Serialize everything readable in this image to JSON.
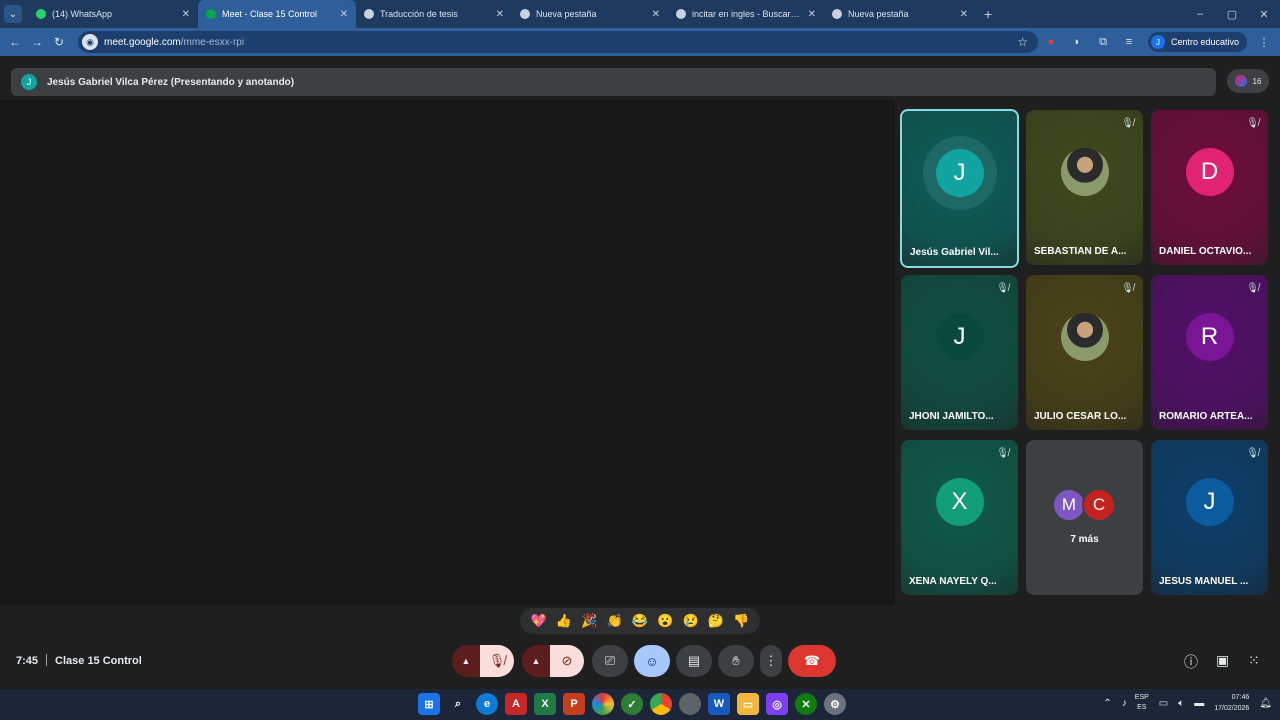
{
  "browser": {
    "tabs": [
      {
        "title": "(14) WhatsApp",
        "icon_color": "#25d366",
        "active": false
      },
      {
        "title": "Meet - Clase 15 Control",
        "icon_color": "#00ac47",
        "active": true
      },
      {
        "title": "Traducción de tesis",
        "icon_color": "#c8d2de",
        "active": false
      },
      {
        "title": "Nueva pestaña",
        "icon_color": "#c8d2de",
        "active": false
      },
      {
        "title": "incitar en ingles - Buscar con Google",
        "icon_color": "#c8d2de",
        "active": false
      },
      {
        "title": "Nueva pestaña",
        "icon_color": "#c8d2de",
        "active": false
      }
    ],
    "url_host": "meet.google.com",
    "url_path": "/mme-esxx-rpi",
    "profile_initial": "J",
    "profile_label": "Centro educativo"
  },
  "meet": {
    "presenter_initial": "J",
    "presenter_banner": "Jesús Gabriel Vilca Pérez (Presentando y anotando)",
    "participant_count": "16",
    "tiles": [
      {
        "name": "Jesús Gabriel Vil...",
        "initial": "J",
        "avatar_color": "#12a4a0",
        "bg": "#0d5d5a",
        "speaking": true,
        "muted": false,
        "photo": false
      },
      {
        "name": "SEBASTIAN DE A...",
        "initial": "",
        "avatar_color": "",
        "bg": "#3f4a1e",
        "speaking": false,
        "muted": true,
        "photo": true
      },
      {
        "name": "DANIEL OCTAVIO...",
        "initial": "D",
        "avatar_color": "#e02473",
        "bg": "#6d0d3b",
        "speaking": false,
        "muted": true,
        "photo": false
      },
      {
        "name": "JHONI JAMILTO...",
        "initial": "J",
        "avatar_color": "#0a4a3c",
        "bg": "#0f5042",
        "speaking": false,
        "muted": true,
        "photo": false
      },
      {
        "name": "JULIO CESAR LO...",
        "initial": "",
        "avatar_color": "",
        "bg": "#4a4318",
        "speaking": false,
        "muted": true,
        "photo": true
      },
      {
        "name": "ROMARIO ARTEA...",
        "initial": "R",
        "avatar_color": "#7a1596",
        "bg": "#530f6a",
        "speaking": false,
        "muted": true,
        "photo": false
      },
      {
        "name": "XENA NAYELY Q...",
        "initial": "X",
        "avatar_color": "#129e77",
        "bg": "#0e5a48",
        "speaking": false,
        "muted": true,
        "photo": false
      },
      {
        "name": "JESUS MANUEL ...",
        "initial": "J",
        "avatar_color": "#0b5b9e",
        "bg": "#0c3f6b",
        "speaking": false,
        "muted": true,
        "photo": false
      }
    ],
    "more": {
      "initials": [
        "M",
        "C"
      ],
      "colors": [
        "#7e57c2",
        "#c5221f"
      ],
      "label": "7 más"
    },
    "reactions": [
      "💖",
      "👍",
      "🎉",
      "👏",
      "😂",
      "😮",
      "😢",
      "🤔",
      "👎"
    ],
    "time": "7:45",
    "meeting_name": "Clase 15 Control"
  },
  "taskbar": {
    "lang_top": "ESP",
    "lang_bottom": "ES",
    "clock_time": "07:46",
    "clock_date": "17/02/2026"
  }
}
